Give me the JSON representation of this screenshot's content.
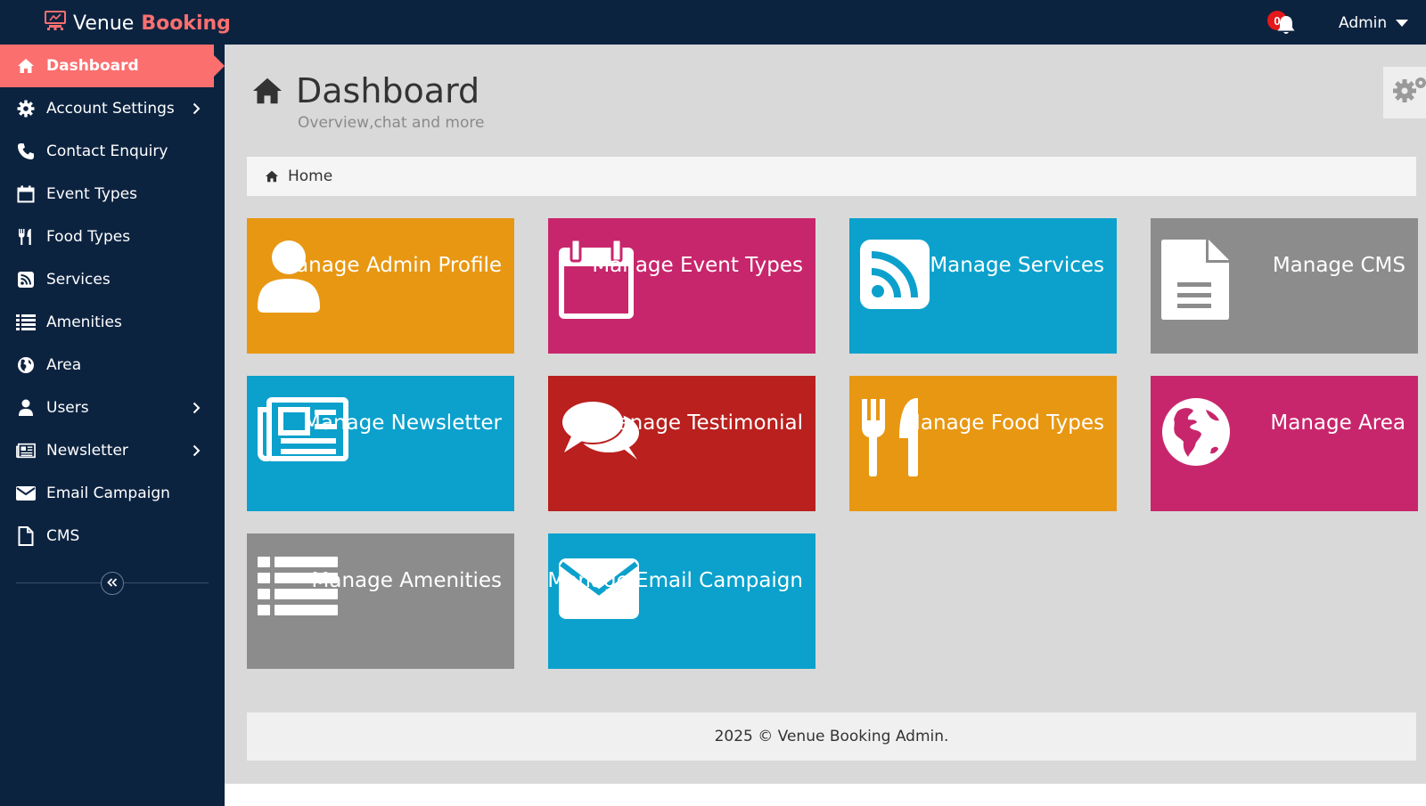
{
  "header": {
    "brand_name": "Venue",
    "brand_accent": "Booking",
    "notification_count": "0",
    "user_label": "Admin"
  },
  "sidebar": {
    "items": [
      {
        "label": "Dashboard",
        "icon": "home-icon",
        "active": true
      },
      {
        "label": "Account Settings",
        "icon": "gear-icon",
        "submenu": true
      },
      {
        "label": "Contact Enquiry",
        "icon": "phone-icon"
      },
      {
        "label": "Event Types",
        "icon": "calendar-icon"
      },
      {
        "label": "Food Types",
        "icon": "cutlery-icon"
      },
      {
        "label": "Services",
        "icon": "rss-icon"
      },
      {
        "label": "Amenities",
        "icon": "list-icon"
      },
      {
        "label": "Area",
        "icon": "globe-icon"
      },
      {
        "label": "Users",
        "icon": "user-icon",
        "submenu": true
      },
      {
        "label": "Newsletter",
        "icon": "newspaper-icon",
        "submenu": true
      },
      {
        "label": "Email Campaign",
        "icon": "envelope-icon"
      },
      {
        "label": "CMS",
        "icon": "file-icon"
      }
    ]
  },
  "page": {
    "title": "Dashboard",
    "subtitle": "Overview,chat and more",
    "breadcrumb": "Home"
  },
  "tiles": [
    {
      "label": "Manage Admin Profile",
      "icon": "user-icon",
      "color": "#e89712"
    },
    {
      "label": "Manage Event Types",
      "icon": "calendar-icon",
      "color": "#c8266c"
    },
    {
      "label": "Manage Services",
      "icon": "rss-icon",
      "color": "#0ba1cc"
    },
    {
      "label": "Manage CMS",
      "icon": "file-icon",
      "color": "#8c8c8c"
    },
    {
      "label": "Manage Newsletter",
      "icon": "newspaper-icon",
      "color": "#0ba1cc"
    },
    {
      "label": "Manage Testimonial",
      "icon": "comments-icon",
      "color": "#b9201e"
    },
    {
      "label": "Manage Food Types",
      "icon": "cutlery-icon",
      "color": "#e89712"
    },
    {
      "label": "Manage Area",
      "icon": "globe-icon",
      "color": "#c8266c"
    },
    {
      "label": "Manage Amenities",
      "icon": "list-icon",
      "color": "#8c8c8c"
    },
    {
      "label": "Manage Email Campaign",
      "icon": "envelope-icon",
      "color": "#0ba1cc"
    }
  ],
  "footer": {
    "text": "2025 © Venue Booking Admin."
  },
  "colors": {
    "navy": "#0c2340",
    "accent": "#fb6f6f",
    "badge": "#e4191b"
  }
}
